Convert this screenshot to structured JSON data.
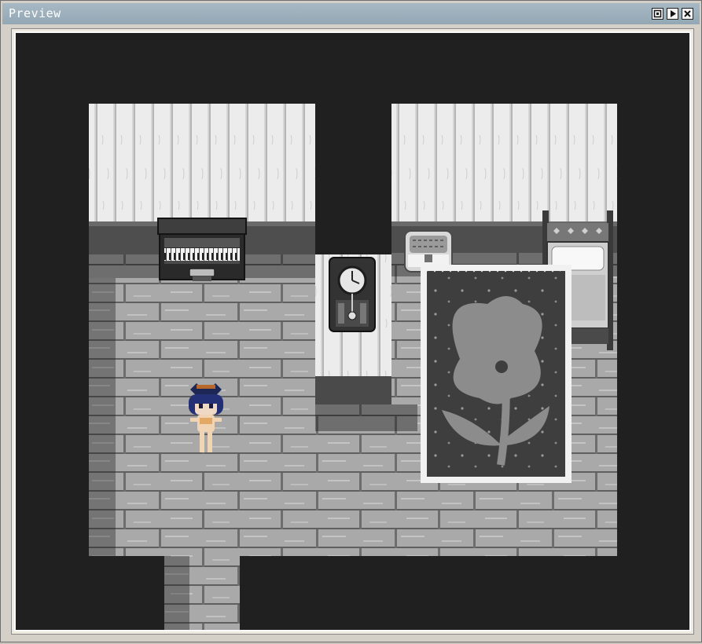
{
  "window": {
    "title": "Preview",
    "buttons": [
      {
        "name": "maximize-button",
        "icon": "maximize-icon"
      },
      {
        "name": "play-button",
        "icon": "play-icon"
      },
      {
        "name": "close-button",
        "icon": "close-icon"
      }
    ]
  },
  "scene": {
    "background": "#202020",
    "objects": [
      "left-wall",
      "right-wall",
      "piano",
      "pendulum-clock",
      "storage-chest",
      "bed",
      "flower-rug",
      "player-character",
      "floor",
      "doorway"
    ]
  }
}
